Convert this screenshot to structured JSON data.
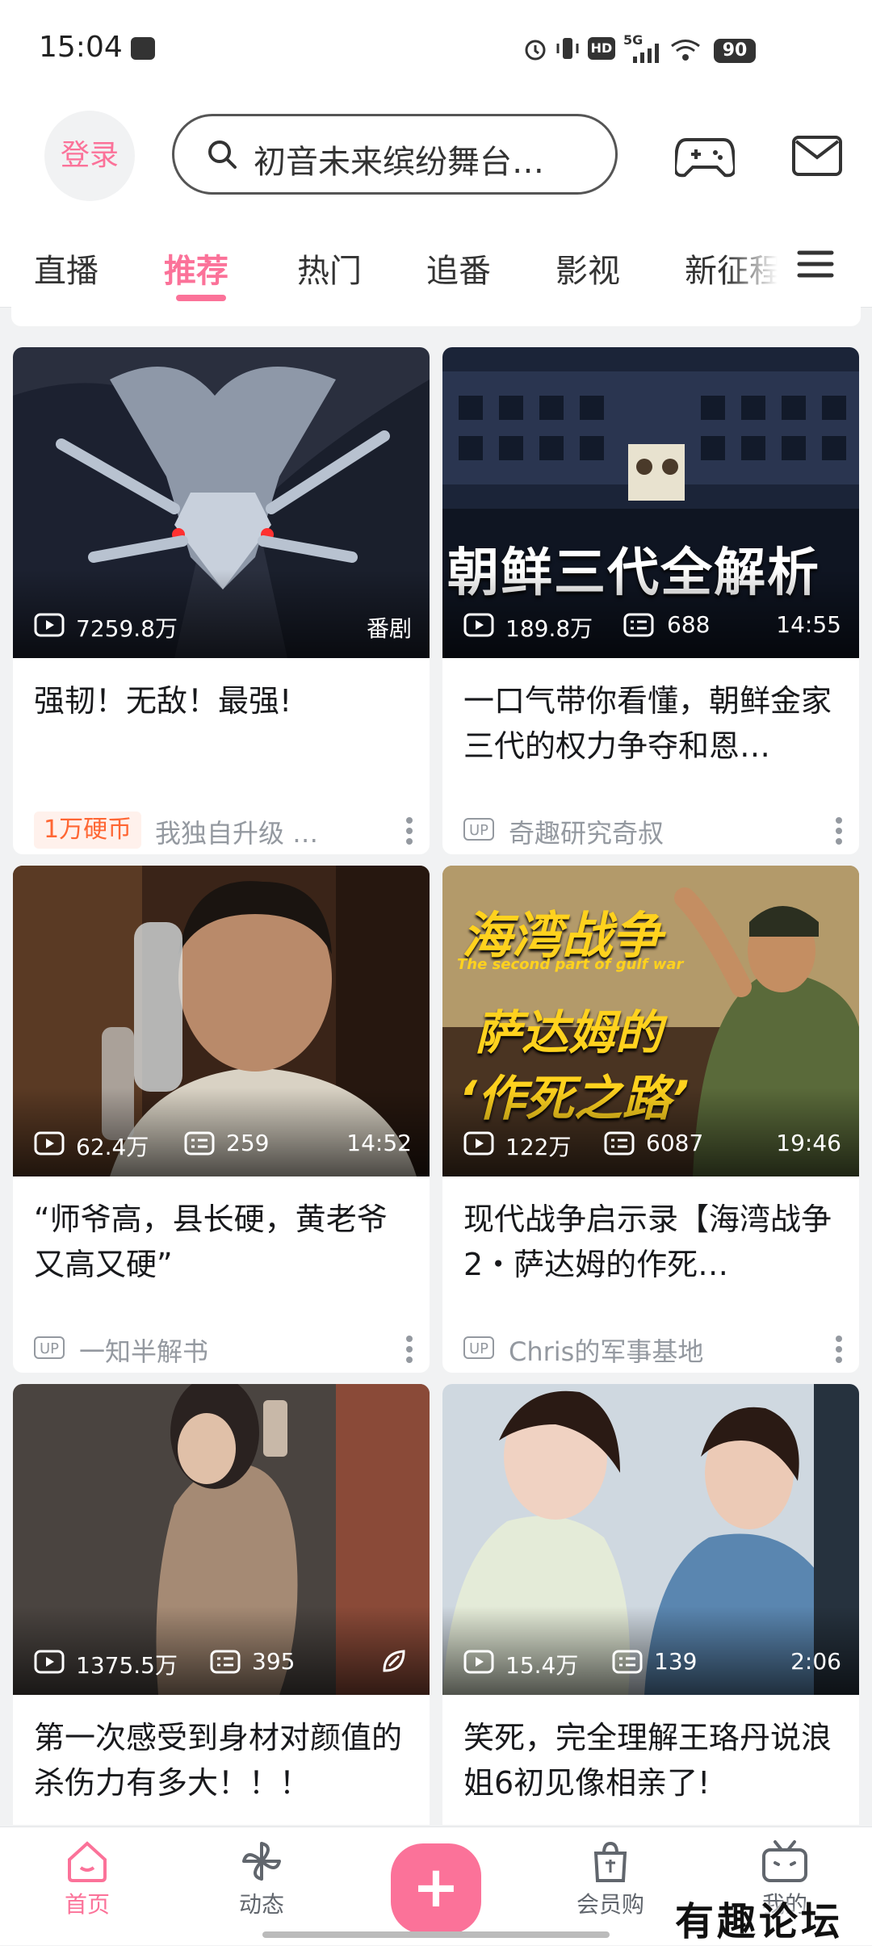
{
  "status_bar": {
    "time": "15:04",
    "battery": "90",
    "network": "5G",
    "hd": "HD"
  },
  "header": {
    "login_label": "登录",
    "search_placeholder": "初音未来缤纷舞台…"
  },
  "tabs": [
    {
      "label": "直播"
    },
    {
      "label": "推荐"
    },
    {
      "label": "热门"
    },
    {
      "label": "追番"
    },
    {
      "label": "影视"
    },
    {
      "label": "新征程"
    }
  ],
  "active_tab": "推荐",
  "cards": [
    {
      "views": "7259.8万",
      "danmaku": "",
      "duration": "番剧",
      "title": "强韧！无敌！最强!",
      "coin_badge": "1万硬币",
      "up_name": "我独自升级 …",
      "has_up_badge": false
    },
    {
      "views": "189.8万",
      "danmaku": "688",
      "duration": "14:55",
      "title": "一口气带你看懂，朝鲜金家三代的权力争夺和恩…",
      "up_name": "奇趣研究奇叔",
      "thumb_text": "朝鲜三代全解析",
      "has_up_badge": true
    },
    {
      "views": "62.4万",
      "danmaku": "259",
      "duration": "14:52",
      "title": "“师爷高，县长硬，黄老爷又高又硬”",
      "up_name": "一知半解书",
      "has_up_badge": true
    },
    {
      "views": "122万",
      "danmaku": "6087",
      "duration": "19:46",
      "title": "现代战争启示录【海湾战争2・萨达姆的作死…",
      "up_name": "Chris的军事基地",
      "thumb_text_1": "海湾战争",
      "thumb_text_2": "The second part of gulf war",
      "thumb_text_3": "萨达姆的",
      "thumb_text_4": "‘作死之路’",
      "has_up_badge": true
    },
    {
      "views": "1375.5万",
      "danmaku": "395",
      "duration": "",
      "title": "第一次感受到身材对颜值的杀伤力有多大！！！"
    },
    {
      "views": "15.4万",
      "danmaku": "139",
      "duration": "2:06",
      "title": "笑死，完全理解王珞丹说浪姐6初见像相亲了!"
    }
  ],
  "bottom_nav": [
    {
      "label": "首页"
    },
    {
      "label": "动态"
    },
    {
      "label": "+"
    },
    {
      "label": "会员购"
    },
    {
      "label": "我的"
    }
  ],
  "watermark": "有趣论坛",
  "colors": {
    "accent": "#fb7299",
    "coin": "#ff6633",
    "text_secondary": "#9499a0"
  }
}
